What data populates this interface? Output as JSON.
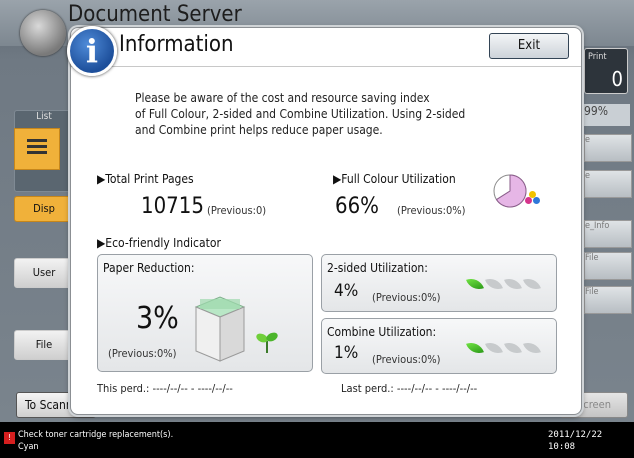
{
  "background": {
    "app_title": "Document Server",
    "list_tab": "List",
    "disp_tab": "Disp",
    "user_tab": "User",
    "file_tab": "File",
    "to_scanner": "To Scann",
    "print_label": "Print",
    "print_count": "0",
    "percent": "99%",
    "screen_button": "Screen",
    "right_buttons": [
      "e",
      "e",
      "e_Info",
      "File",
      "File"
    ]
  },
  "status": {
    "message_line1": "Check toner cartridge replacement(s).",
    "message_line2": "Cyan",
    "date": "2011/12/22",
    "time": "10:08"
  },
  "dialog": {
    "title": "Information",
    "exit_label": "Exit",
    "notice_lines": [
      "Please be aware of the cost and resource saving index",
      "of Full Colour, 2-sided and Combine Utilization. Using 2-sided",
      "and Combine print helps reduce paper usage."
    ],
    "total_print": {
      "label": "▶Total Print Pages",
      "value": "10715",
      "previous": "(Previous:0)"
    },
    "full_colour": {
      "label": "▶Full Colour Utilization",
      "value": "66%",
      "previous": "(Previous:0%)",
      "fraction": 0.66
    },
    "eco_label": "▶Eco-friendly Indicator",
    "paper_reduction": {
      "label": "Paper Reduction:",
      "value": "3%",
      "previous": "(Previous:0%)"
    },
    "two_sided": {
      "label": "2-sided Utilization:",
      "value": "4%",
      "previous": "(Previous:0%)",
      "leaves_on": 1,
      "leaves_total": 4
    },
    "combine": {
      "label": "Combine Utilization:",
      "value": "1%",
      "previous": "(Previous:0%)",
      "leaves_on": 1,
      "leaves_total": 4
    },
    "this_period": "This perd.:   ----/--/--  -  ----/--/--",
    "last_period": "Last perd.:   ----/--/--  -  ----/--/--"
  },
  "colors": {
    "pie_fill": "#e6b6e6",
    "leaf_on": "#3fb824",
    "leaf_off": "#c7cacc"
  }
}
